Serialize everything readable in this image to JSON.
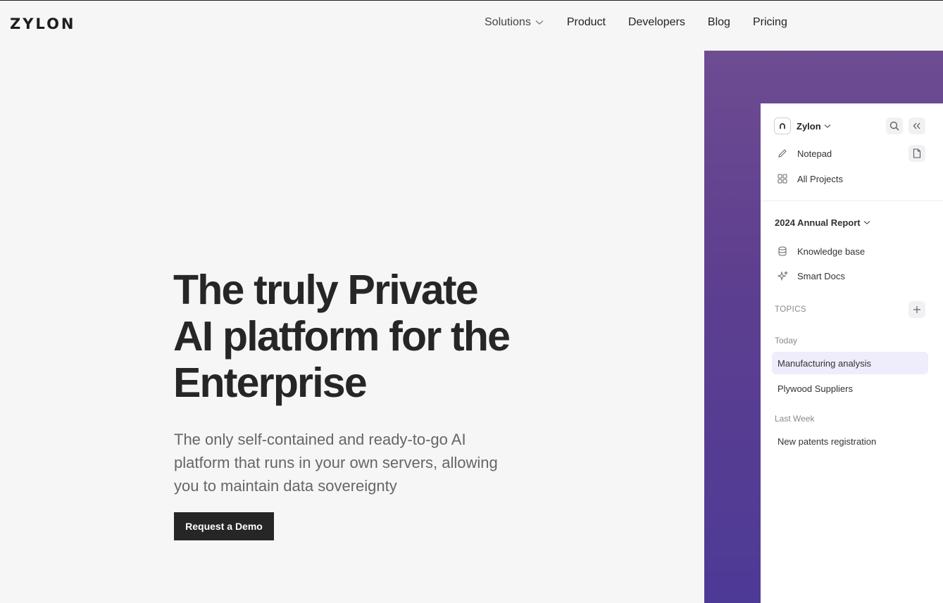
{
  "brand": {
    "logo_text": "ZYLON"
  },
  "nav": {
    "items": [
      {
        "label": "Solutions",
        "has_dropdown": true
      },
      {
        "label": "Product"
      },
      {
        "label": "Developers"
      },
      {
        "label": "Blog"
      },
      {
        "label": "Pricing"
      }
    ]
  },
  "hero": {
    "title": "The truly Private\nAI platform for the\nEnterprise",
    "subtitle": "The only self-contained and ready-to-go AI platform that runs in your own servers, allowing you to maintain data sovereignty",
    "cta_label": "Request a Demo"
  },
  "app_preview": {
    "workspace": {
      "name": "Zylon",
      "icon": "chevron-down-icon"
    },
    "header_buttons": [
      "search-icon",
      "collapse-sidebar-icon"
    ],
    "top_items": [
      {
        "label": "Notepad",
        "icon": "pencil-icon",
        "action_icon": "new-note-icon"
      },
      {
        "label": "All Projects",
        "icon": "grid-icon"
      }
    ],
    "project": {
      "name": "2024 Annual Report"
    },
    "project_items": [
      {
        "label": "Knowledge base",
        "icon": "database-icon"
      },
      {
        "label": "Smart Docs",
        "icon": "sparkle-icon"
      }
    ],
    "topics_label": "TOPICS",
    "groups": [
      {
        "label": "Today",
        "items": [
          {
            "label": "Manufacturing analysis",
            "active": true
          },
          {
            "label": "Plywood Suppliers",
            "active": false
          }
        ]
      },
      {
        "label": "Last Week",
        "items": [
          {
            "label": "New patents registration",
            "active": false
          }
        ]
      }
    ]
  },
  "colors": {
    "background": "#f6f6f6",
    "cta_background": "#262626",
    "gradient_top": "#6e4c92",
    "gradient_bottom": "#4d3a96",
    "active_topic_bg": "#efecfb"
  }
}
